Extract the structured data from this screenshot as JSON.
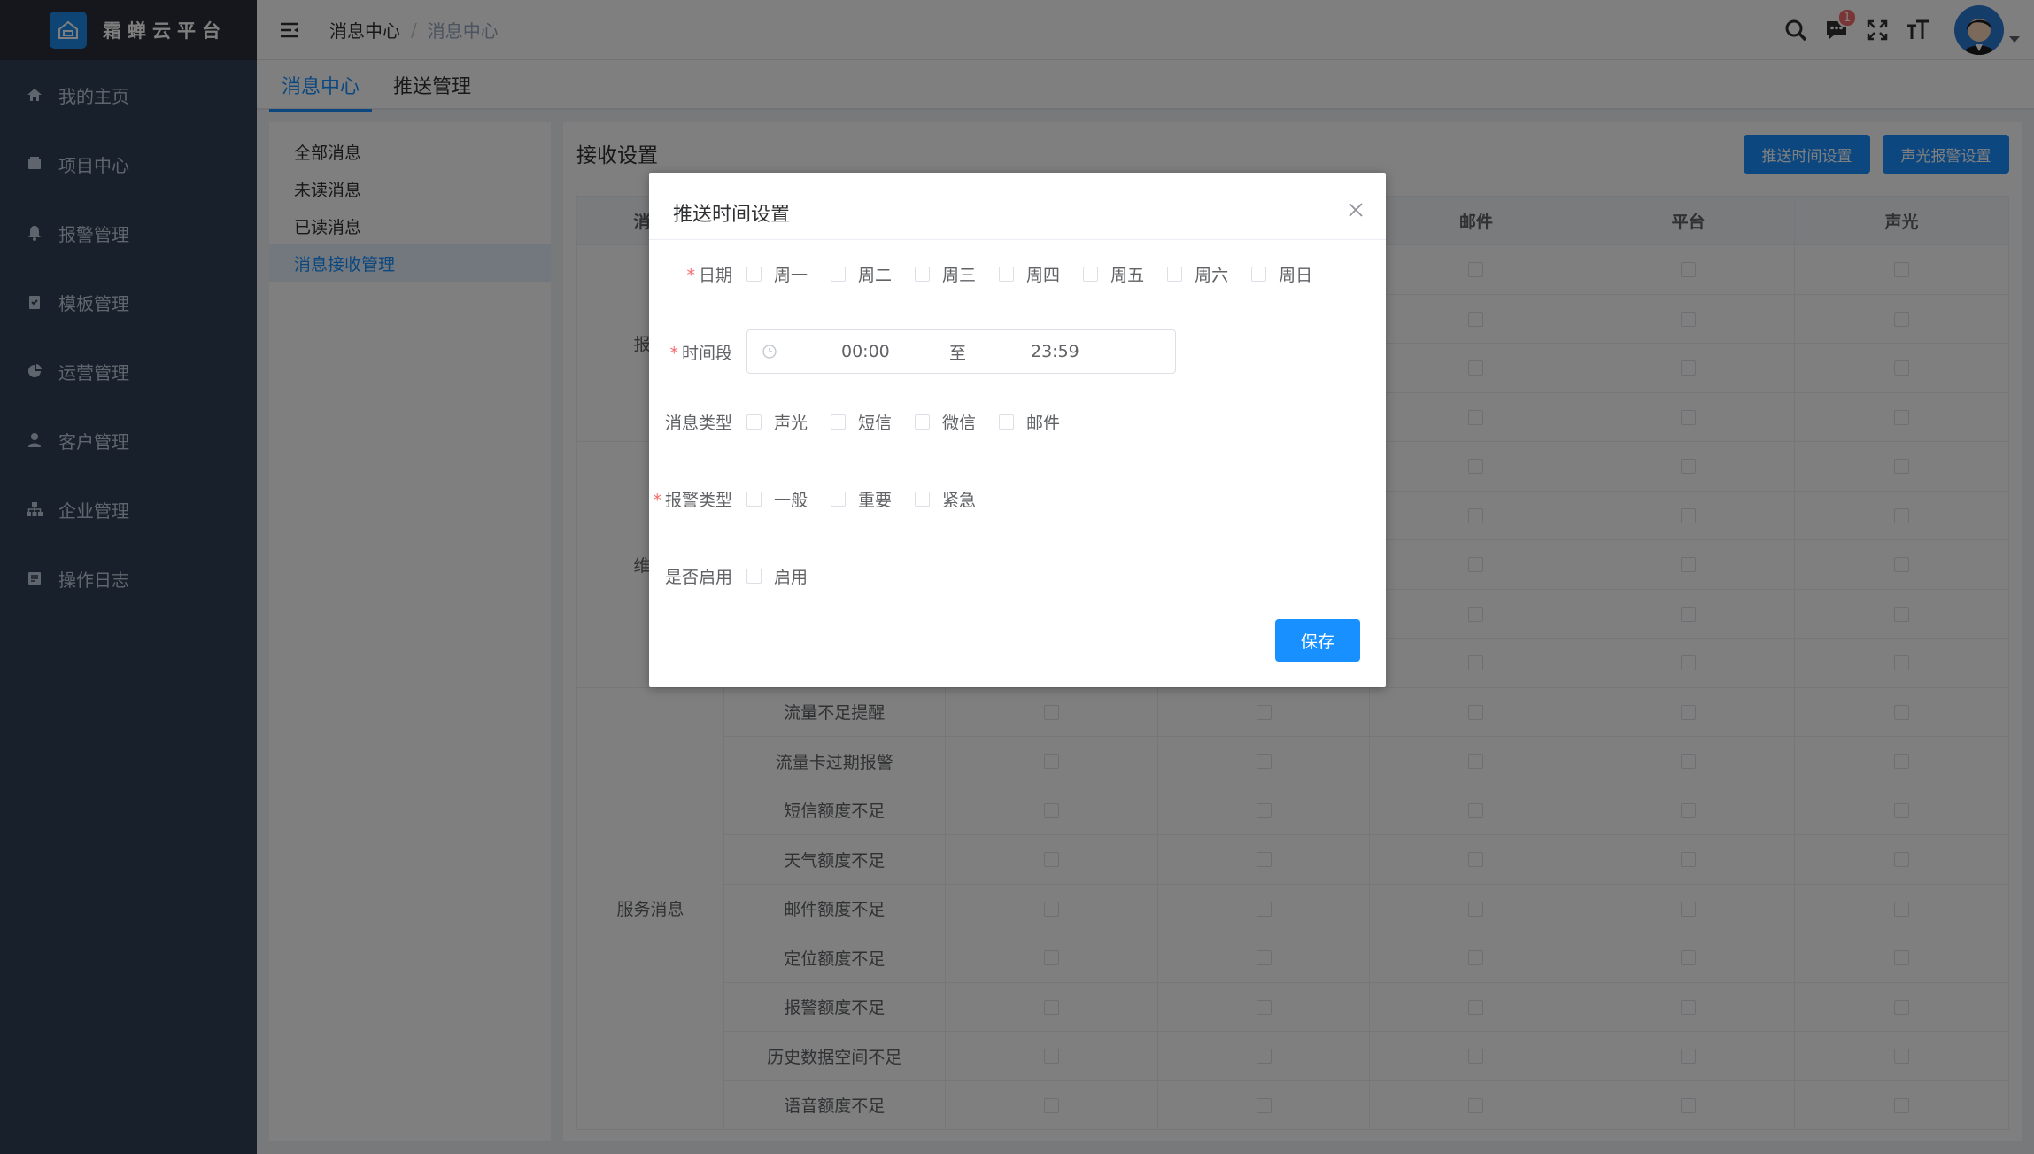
{
  "app": {
    "logo_text": "霜蝉云平台"
  },
  "sidebar": {
    "items": [
      {
        "label": "我的主页",
        "icon": "home-icon"
      },
      {
        "label": "项目中心",
        "icon": "folder-icon"
      },
      {
        "label": "报警管理",
        "icon": "bell-icon"
      },
      {
        "label": "模板管理",
        "icon": "clipboard-check-icon"
      },
      {
        "label": "运营管理",
        "icon": "pie-chart-icon"
      },
      {
        "label": "客户管理",
        "icon": "user-icon"
      },
      {
        "label": "企业管理",
        "icon": "org-chart-icon"
      },
      {
        "label": "操作日志",
        "icon": "log-icon"
      }
    ]
  },
  "header": {
    "breadcrumb": [
      "消息中心",
      "消息中心"
    ],
    "notification_count": "1"
  },
  "tabs": [
    {
      "label": "消息中心"
    },
    {
      "label": "推送管理"
    }
  ],
  "left_menu": [
    {
      "label": "全部消息"
    },
    {
      "label": "未读消息"
    },
    {
      "label": "已读消息"
    },
    {
      "label": "消息接收管理"
    }
  ],
  "main": {
    "title": "接收设置",
    "btn_push_time": "推送时间设置",
    "btn_sound_alarm": "声光报警设置",
    "table": {
      "headers": [
        "消息",
        "",
        "",
        "",
        "邮件",
        "平台",
        "声光"
      ],
      "group_labels": [
        "报警",
        "维保",
        "服务消息"
      ],
      "service_rows": [
        "流量不足提醒",
        "流量卡过期报警",
        "短信额度不足",
        "天气额度不足",
        "邮件额度不足",
        "定位额度不足",
        "报警额度不足",
        "历史数据空间不足",
        "语音额度不足"
      ]
    }
  },
  "dialog": {
    "title": "推送时间设置",
    "date_label": "日期",
    "days": [
      "周一",
      "周二",
      "周三",
      "周四",
      "周五",
      "周六",
      "周日"
    ],
    "time_label": "时间段",
    "time_start": "00:00",
    "time_sep": "至",
    "time_end": "23:59",
    "msg_type_label": "消息类型",
    "msg_types": [
      "声光",
      "短信",
      "微信",
      "邮件"
    ],
    "alarm_type_label": "报警类型",
    "alarm_types": [
      "一般",
      "重要",
      "紧急"
    ],
    "enable_label": "是否启用",
    "enable_option": "启用",
    "save_label": "保存"
  },
  "colors": {
    "primary": "#1890ff",
    "sidebar_bg": "#304156",
    "logo_bg": "#2b2f3a",
    "required": "#f56c6c"
  }
}
